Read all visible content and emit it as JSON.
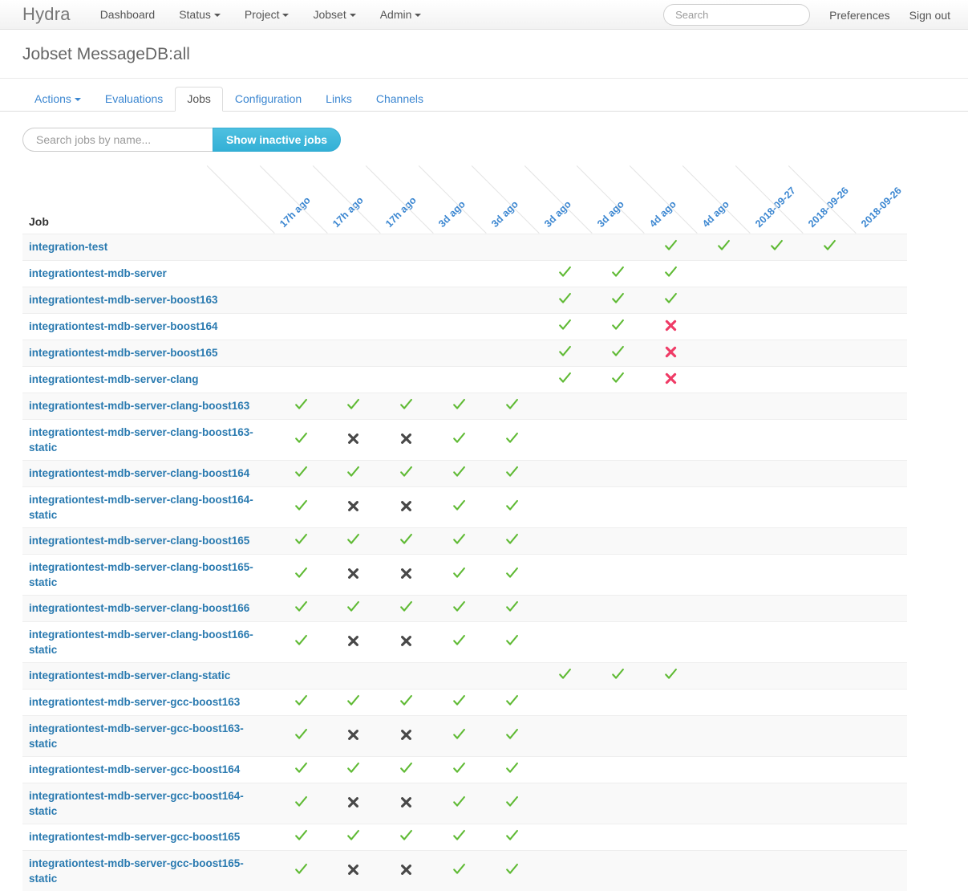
{
  "navbar": {
    "brand": "Hydra",
    "items": [
      {
        "label": "Dashboard",
        "caret": false,
        "name": "dashboard"
      },
      {
        "label": "Status",
        "caret": true,
        "name": "status"
      },
      {
        "label": "Project",
        "caret": true,
        "name": "project"
      },
      {
        "label": "Jobset",
        "caret": true,
        "name": "jobset"
      },
      {
        "label": "Admin",
        "caret": true,
        "name": "admin"
      }
    ],
    "search_placeholder": "Search",
    "search_value": "",
    "preferences": "Preferences",
    "signout": "Sign out"
  },
  "page": {
    "title": "Jobset MessageDB:all"
  },
  "tabs": [
    {
      "label": "Actions",
      "caret": true,
      "active": false,
      "name": "actions"
    },
    {
      "label": "Evaluations",
      "caret": false,
      "active": false,
      "name": "evaluations"
    },
    {
      "label": "Jobs",
      "caret": false,
      "active": true,
      "name": "jobs"
    },
    {
      "label": "Configuration",
      "caret": false,
      "active": false,
      "name": "configuration"
    },
    {
      "label": "Links",
      "caret": false,
      "active": false,
      "name": "links"
    },
    {
      "label": "Channels",
      "caret": false,
      "active": false,
      "name": "channels"
    }
  ],
  "filter": {
    "placeholder": "Search jobs by name...",
    "value": "",
    "button_label": "Show inactive jobs"
  },
  "table": {
    "job_column_header": "Job",
    "eval_headers": [
      "17h ago",
      "17h ago",
      "17h ago",
      "3d ago",
      "3d ago",
      "3d ago",
      "3d ago",
      "4d ago",
      "4d ago",
      "2018-09-27",
      "2018-09-26",
      "2018-09-26"
    ],
    "status_legend": {
      "success": "success-check",
      "failed": "failed-cross",
      "aborted": "aborted-cross",
      "none": ""
    },
    "colors": {
      "success": "#5fba34",
      "failed": "#ef3b66",
      "aborted": "#484848",
      "link": "#2a7ab0",
      "header_link": "#3c87d1",
      "accent_button": "#33b0d6"
    },
    "rows": [
      {
        "job": "integration-test",
        "cells": [
          "",
          "",
          "",
          "",
          "",
          "",
          "",
          "success",
          "success",
          "success",
          "success",
          ""
        ]
      },
      {
        "job": "integrationtest-mdb-server",
        "cells": [
          "",
          "",
          "",
          "",
          "",
          "success",
          "success",
          "success",
          "",
          "",
          "",
          ""
        ]
      },
      {
        "job": "integrationtest-mdb-server-boost163",
        "cells": [
          "",
          "",
          "",
          "",
          "",
          "success",
          "success",
          "success",
          "",
          "",
          "",
          ""
        ]
      },
      {
        "job": "integrationtest-mdb-server-boost164",
        "cells": [
          "",
          "",
          "",
          "",
          "",
          "success",
          "success",
          "failed",
          "",
          "",
          "",
          ""
        ]
      },
      {
        "job": "integrationtest-mdb-server-boost165",
        "cells": [
          "",
          "",
          "",
          "",
          "",
          "success",
          "success",
          "failed",
          "",
          "",
          "",
          ""
        ]
      },
      {
        "job": "integrationtest-mdb-server-clang",
        "cells": [
          "",
          "",
          "",
          "",
          "",
          "success",
          "success",
          "failed",
          "",
          "",
          "",
          ""
        ]
      },
      {
        "job": "integrationtest-mdb-server-clang-boost163",
        "cells": [
          "success",
          "success",
          "success",
          "success",
          "success",
          "",
          "",
          "",
          "",
          "",
          "",
          ""
        ]
      },
      {
        "job": "integrationtest-mdb-server-clang-boost163-static",
        "cells": [
          "success",
          "aborted",
          "aborted",
          "success",
          "success",
          "",
          "",
          "",
          "",
          "",
          "",
          ""
        ]
      },
      {
        "job": "integrationtest-mdb-server-clang-boost164",
        "cells": [
          "success",
          "success",
          "success",
          "success",
          "success",
          "",
          "",
          "",
          "",
          "",
          "",
          ""
        ]
      },
      {
        "job": "integrationtest-mdb-server-clang-boost164-static",
        "cells": [
          "success",
          "aborted",
          "aborted",
          "success",
          "success",
          "",
          "",
          "",
          "",
          "",
          "",
          ""
        ]
      },
      {
        "job": "integrationtest-mdb-server-clang-boost165",
        "cells": [
          "success",
          "success",
          "success",
          "success",
          "success",
          "",
          "",
          "",
          "",
          "",
          "",
          ""
        ]
      },
      {
        "job": "integrationtest-mdb-server-clang-boost165-static",
        "cells": [
          "success",
          "aborted",
          "aborted",
          "success",
          "success",
          "",
          "",
          "",
          "",
          "",
          "",
          ""
        ]
      },
      {
        "job": "integrationtest-mdb-server-clang-boost166",
        "cells": [
          "success",
          "success",
          "success",
          "success",
          "success",
          "",
          "",
          "",
          "",
          "",
          "",
          ""
        ]
      },
      {
        "job": "integrationtest-mdb-server-clang-boost166-static",
        "cells": [
          "success",
          "aborted",
          "aborted",
          "success",
          "success",
          "",
          "",
          "",
          "",
          "",
          "",
          ""
        ]
      },
      {
        "job": "integrationtest-mdb-server-clang-static",
        "cells": [
          "",
          "",
          "",
          "",
          "",
          "success",
          "success",
          "success",
          "",
          "",
          "",
          ""
        ]
      },
      {
        "job": "integrationtest-mdb-server-gcc-boost163",
        "cells": [
          "success",
          "success",
          "success",
          "success",
          "success",
          "",
          "",
          "",
          "",
          "",
          "",
          ""
        ]
      },
      {
        "job": "integrationtest-mdb-server-gcc-boost163-static",
        "cells": [
          "success",
          "aborted",
          "aborted",
          "success",
          "success",
          "",
          "",
          "",
          "",
          "",
          "",
          ""
        ]
      },
      {
        "job": "integrationtest-mdb-server-gcc-boost164",
        "cells": [
          "success",
          "success",
          "success",
          "success",
          "success",
          "",
          "",
          "",
          "",
          "",
          "",
          ""
        ]
      },
      {
        "job": "integrationtest-mdb-server-gcc-boost164-static",
        "cells": [
          "success",
          "aborted",
          "aborted",
          "success",
          "success",
          "",
          "",
          "",
          "",
          "",
          "",
          ""
        ]
      },
      {
        "job": "integrationtest-mdb-server-gcc-boost165",
        "cells": [
          "success",
          "success",
          "success",
          "success",
          "success",
          "",
          "",
          "",
          "",
          "",
          "",
          ""
        ]
      },
      {
        "job": "integrationtest-mdb-server-gcc-boost165-static",
        "cells": [
          "success",
          "aborted",
          "aborted",
          "success",
          "success",
          "",
          "",
          "",
          "",
          "",
          "",
          ""
        ]
      }
    ]
  }
}
